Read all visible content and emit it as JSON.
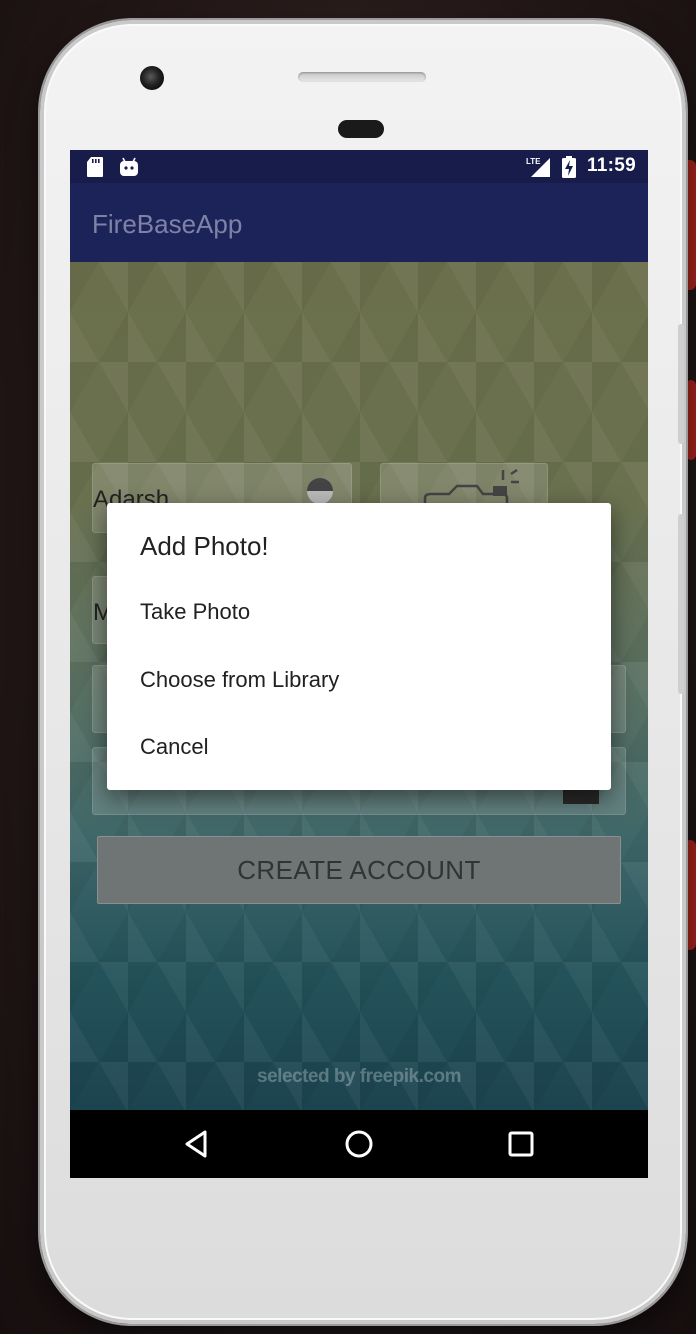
{
  "status_bar": {
    "time": "11:59",
    "left_icons": [
      "sd-card-icon",
      "android-icon"
    ],
    "right_icons": [
      "lte-signal-icon",
      "battery-charging-icon"
    ]
  },
  "app_bar": {
    "title": "FireBaseApp",
    "color": "#1c2358"
  },
  "form": {
    "name_value": "Adarsh",
    "second_field_value": "M",
    "create_button_label": "CREATE ACCOUNT"
  },
  "dialog": {
    "title": "Add Photo!",
    "options": [
      "Take Photo",
      "Choose from Library",
      "Cancel"
    ]
  },
  "credit": {
    "text": "selected by freepik.com"
  },
  "nav_bar": {
    "buttons": [
      "back-icon",
      "home-icon",
      "recents-icon"
    ]
  }
}
